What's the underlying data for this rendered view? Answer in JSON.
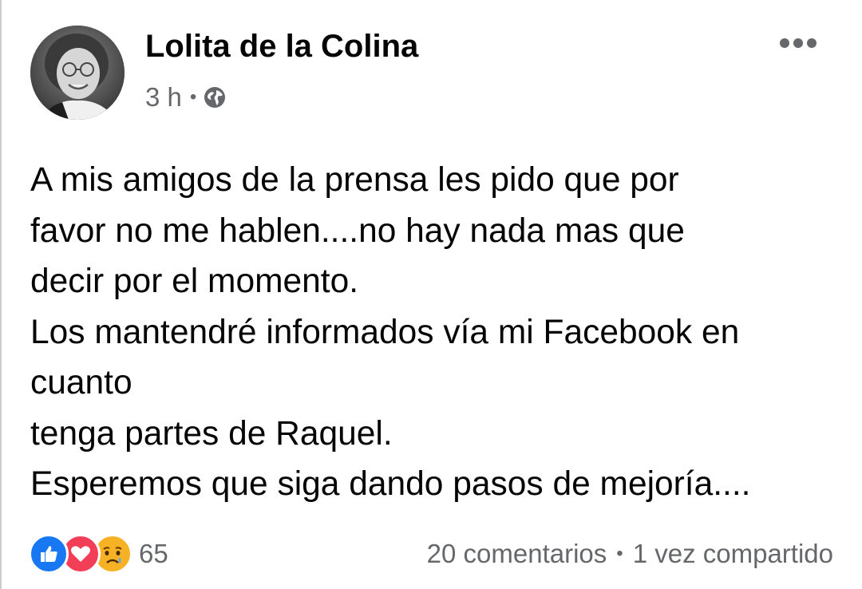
{
  "post": {
    "author": "Lolita de la Colina",
    "time": "3 h",
    "separator": "•",
    "privacy_icon": "globe-icon",
    "more_icon": "more-options-icon",
    "text_lines": [
      "A mis amigos de la prensa les pido que por",
      "favor no me hablen....no hay nada mas que",
      "decir por el momento.",
      "Los mantendré informados vía mi Facebook en",
      "cuanto",
      "tenga partes de Raquel.",
      "Esperemos que siga dando pasos de mejoría...."
    ],
    "reactions": {
      "icons": [
        "like-icon",
        "love-icon",
        "sad-icon"
      ],
      "count": "65"
    },
    "stats": {
      "comments": "20 comentarios",
      "separator": "•",
      "shares": "1 vez compartido"
    }
  },
  "colors": {
    "like": "#1877f2",
    "love": "#f33e58",
    "sad": "#f7b125",
    "secondary_text": "#65676b",
    "primary_text": "#050505"
  }
}
